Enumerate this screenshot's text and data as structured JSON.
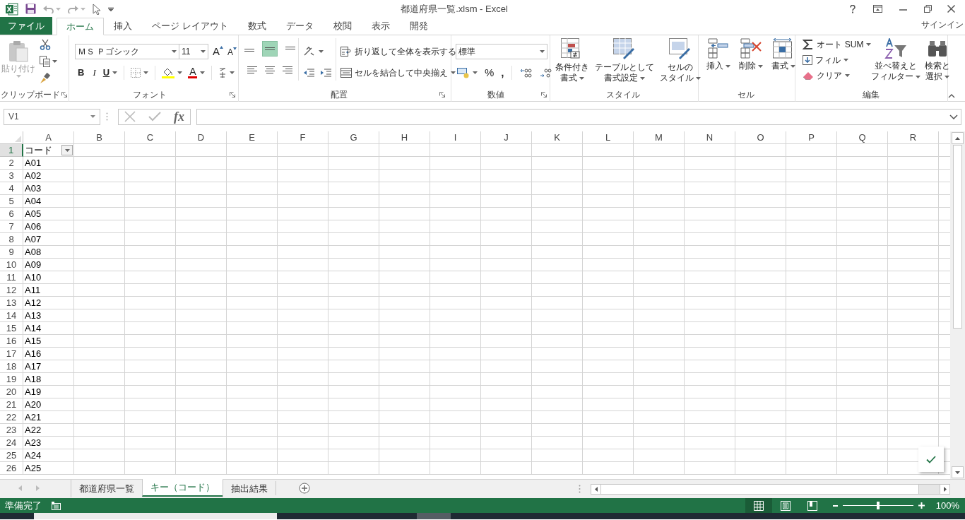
{
  "window": {
    "title": "都道府県一覧.xlsm - Excel",
    "sign_in": "サインイン"
  },
  "ribbon_tabs": [
    {
      "label": "ファイル",
      "kind": "file",
      "selected": false
    },
    {
      "label": "ホーム",
      "kind": "tab",
      "selected": true
    },
    {
      "label": "挿入",
      "kind": "tab",
      "selected": false
    },
    {
      "label": "ページ レイアウト",
      "kind": "tab",
      "selected": false
    },
    {
      "label": "数式",
      "kind": "tab",
      "selected": false
    },
    {
      "label": "データ",
      "kind": "tab",
      "selected": false
    },
    {
      "label": "校閲",
      "kind": "tab",
      "selected": false
    },
    {
      "label": "表示",
      "kind": "tab",
      "selected": false
    },
    {
      "label": "開発",
      "kind": "tab",
      "selected": false
    }
  ],
  "ribbon_groups": [
    {
      "kind": "clipboard",
      "label": "クリップボード",
      "launcher": true,
      "paste": "貼り付け"
    },
    {
      "kind": "font",
      "label": "フォント",
      "launcher": true,
      "font_name": "ＭＳ Ｐゴシック",
      "font_size": "11",
      "grow": "A",
      "shrink": "A",
      "bold": "B",
      "italic": "I",
      "underline": "U",
      "font_color": "A"
    },
    {
      "kind": "alignment",
      "label": "配置",
      "launcher": true,
      "wrap": "折り返して全体を表示する",
      "merge": "セルを結合して中央揃え",
      "align_buttons": [
        {
          "selected": false
        },
        {
          "selected": true
        },
        {
          "selected": false
        },
        {
          "selected": false
        },
        {
          "selected": false
        },
        {
          "selected": false
        }
      ]
    },
    {
      "kind": "number",
      "label": "数値",
      "launcher": true,
      "format": "標準",
      "percent": "%",
      "comma": ","
    },
    {
      "kind": "styles",
      "label": "スタイル",
      "buttons": [
        {
          "lines": [
            "条件付き",
            "書式"
          ]
        },
        {
          "lines": [
            "テーブルとして",
            "書式設定"
          ]
        },
        {
          "lines": [
            "セルの",
            "スタイル"
          ]
        }
      ]
    },
    {
      "kind": "cells",
      "label": "セル",
      "buttons": [
        "挿入",
        "削除",
        "書式"
      ]
    },
    {
      "kind": "editing",
      "label": "編集",
      "small": [
        "オート SUM",
        "フィル",
        "クリア"
      ],
      "large": [
        {
          "lines": [
            "並べ替えと",
            "フィルター"
          ]
        },
        {
          "lines": [
            "検索と",
            "選択"
          ]
        }
      ]
    }
  ],
  "formula_bar": {
    "name_box": "V1",
    "function_button": "fx"
  },
  "columns": [
    {
      "label": "A",
      "selected": false
    },
    {
      "label": "B",
      "selected": false
    },
    {
      "label": "C",
      "selected": false
    },
    {
      "label": "D",
      "selected": false
    },
    {
      "label": "E",
      "selected": false
    },
    {
      "label": "F",
      "selected": false
    },
    {
      "label": "G",
      "selected": false
    },
    {
      "label": "H",
      "selected": false
    },
    {
      "label": "I",
      "selected": false
    },
    {
      "label": "J",
      "selected": false
    },
    {
      "label": "K",
      "selected": false
    },
    {
      "label": "L",
      "selected": false
    },
    {
      "label": "M",
      "selected": false
    },
    {
      "label": "N",
      "selected": false
    },
    {
      "label": "O",
      "selected": false
    },
    {
      "label": "P",
      "selected": false
    },
    {
      "label": "Q",
      "selected": false
    },
    {
      "label": "R",
      "selected": false
    }
  ],
  "rows": [
    {
      "number": "1",
      "selected": true,
      "value": "コード",
      "filter": true
    },
    {
      "number": "2",
      "selected": false,
      "value": "A01"
    },
    {
      "number": "3",
      "selected": false,
      "value": "A02"
    },
    {
      "number": "4",
      "selected": false,
      "value": "A03"
    },
    {
      "number": "5",
      "selected": false,
      "value": "A04"
    },
    {
      "number": "6",
      "selected": false,
      "value": "A05"
    },
    {
      "number": "7",
      "selected": false,
      "value": "A06"
    },
    {
      "number": "8",
      "selected": false,
      "value": "A07"
    },
    {
      "number": "9",
      "selected": false,
      "value": "A08"
    },
    {
      "number": "10",
      "selected": false,
      "value": "A09"
    },
    {
      "number": "11",
      "selected": false,
      "value": "A10"
    },
    {
      "number": "12",
      "selected": false,
      "value": "A11"
    },
    {
      "number": "13",
      "selected": false,
      "value": "A12"
    },
    {
      "number": "14",
      "selected": false,
      "value": "A13"
    },
    {
      "number": "15",
      "selected": false,
      "value": "A14"
    },
    {
      "number": "16",
      "selected": false,
      "value": "A15"
    },
    {
      "number": "17",
      "selected": false,
      "value": "A16"
    },
    {
      "number": "18",
      "selected": false,
      "value": "A17"
    },
    {
      "number": "19",
      "selected": false,
      "value": "A18"
    },
    {
      "number": "20",
      "selected": false,
      "value": "A19"
    },
    {
      "number": "21",
      "selected": false,
      "value": "A20"
    },
    {
      "number": "22",
      "selected": false,
      "value": "A21"
    },
    {
      "number": "23",
      "selected": false,
      "value": "A22"
    },
    {
      "number": "24",
      "selected": false,
      "value": "A23"
    },
    {
      "number": "25",
      "selected": false,
      "value": "A24"
    },
    {
      "number": "26",
      "selected": false,
      "value": "A25"
    }
  ],
  "sheet_tabs": [
    {
      "label": "都道府県一覧",
      "selected": false
    },
    {
      "label": "キー（コード）",
      "selected": true
    },
    {
      "label": "抽出結果",
      "selected": false
    }
  ],
  "status_bar": {
    "status": "準備完了",
    "views": [
      {
        "selected": true
      },
      {
        "selected": false
      },
      {
        "selected": false
      }
    ],
    "zoom": {
      "level": 0.5,
      "reading": "100%"
    }
  }
}
